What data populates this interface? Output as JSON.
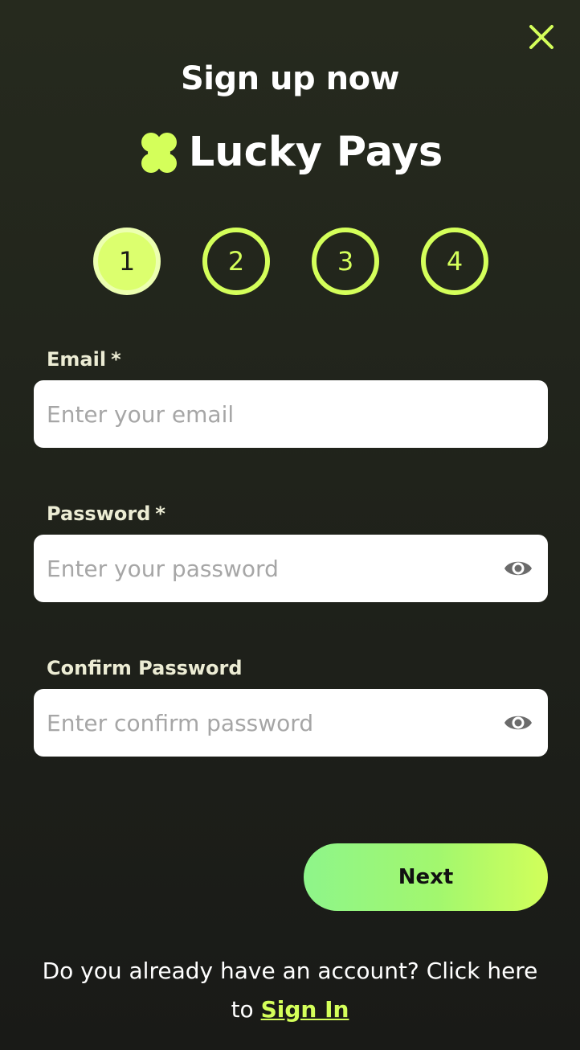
{
  "dialog": {
    "title": "Sign up now",
    "close_icon": "close-icon"
  },
  "brand": {
    "name": "Lucky Pays",
    "icon": "clover-logo-icon",
    "accent_color": "#d4ff5a"
  },
  "steps": {
    "items": [
      {
        "label": "1",
        "active": true
      },
      {
        "label": "2",
        "active": false
      },
      {
        "label": "3",
        "active": false
      },
      {
        "label": "4",
        "active": false
      }
    ]
  },
  "form": {
    "email": {
      "label": "Email",
      "required_mark": "*",
      "value": "",
      "placeholder": "Enter your email"
    },
    "password": {
      "label": "Password",
      "required_mark": "*",
      "value": "",
      "placeholder": "Enter your password",
      "toggle_icon": "eye-icon"
    },
    "confirm_password": {
      "label": "Confirm Password",
      "value": "",
      "placeholder": "Enter confirm password",
      "toggle_icon": "eye-icon"
    }
  },
  "actions": {
    "next_label": "Next"
  },
  "footer": {
    "prompt": "Do you already have an account? Click here to",
    "sign_in_label": "Sign In"
  }
}
